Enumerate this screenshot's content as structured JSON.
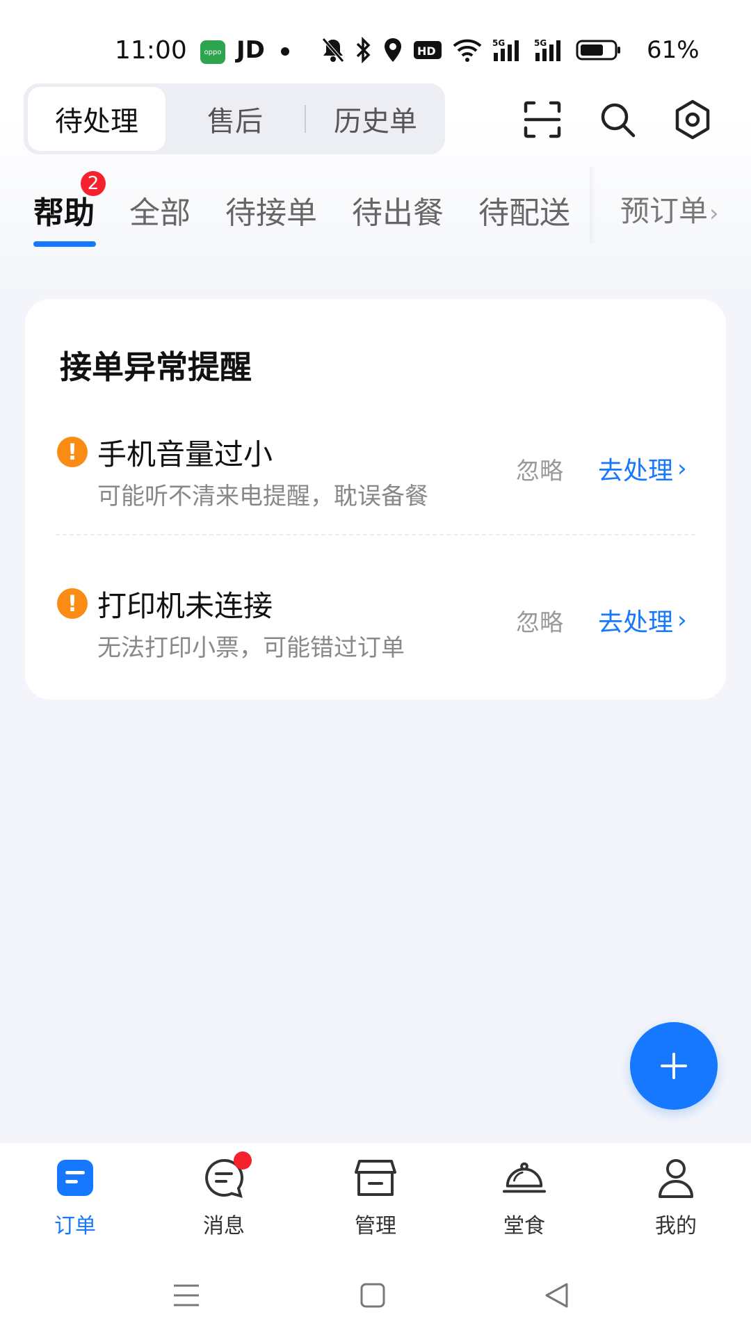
{
  "status_bar": {
    "time": "11:00",
    "carrier_text": "JD",
    "battery_text": "61%",
    "icons": [
      "oppo-app-icon",
      "mute-bell-icon",
      "bluetooth-icon",
      "location-icon",
      "hd-icon",
      "wifi-icon",
      "5g-signal-icon",
      "5g-signal-icon",
      "battery-icon"
    ]
  },
  "header": {
    "segments": [
      "待处理",
      "售后",
      "历史单"
    ],
    "icons": [
      "scan-icon",
      "search-icon",
      "settings-icon"
    ]
  },
  "tabs": {
    "items": [
      "帮助",
      "全部",
      "待接单",
      "待出餐",
      "待配送",
      "预订单"
    ],
    "badge": "2"
  },
  "card": {
    "title": "接单异常提醒",
    "alerts": [
      {
        "title": "手机音量过小",
        "desc": "可能听不清来电提醒，耽误备餐",
        "ignore": "忽略",
        "action": "去处理"
      },
      {
        "title": "打印机未连接",
        "desc": "无法打印小票，可能错过订单",
        "ignore": "忽略",
        "action": "去处理"
      }
    ]
  },
  "bottom_nav": {
    "items": [
      "订单",
      "消息",
      "管理",
      "堂食",
      "我的"
    ]
  },
  "colors": {
    "accent": "#1677FF",
    "warning": "#FA8C16",
    "badge": "#F5222D",
    "background": "#F3F5FA"
  }
}
